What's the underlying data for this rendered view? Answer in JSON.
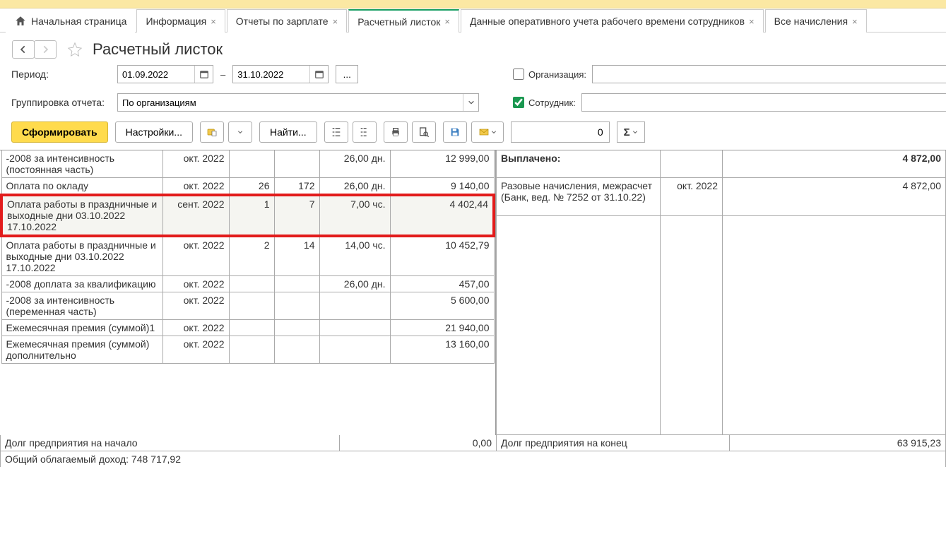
{
  "tabs": {
    "home": "Начальная страница",
    "info": "Информация",
    "reports": "Отчеты по зарплате",
    "payslip": "Расчетный листок",
    "worktime": "Данные оперативного учета рабочего времени сотрудников",
    "accruals": "Все начисления"
  },
  "title": "Расчетный листок",
  "labels": {
    "period": "Период:",
    "grouping": "Группировка отчета:",
    "org": "Организация:",
    "emp": "Сотрудник:"
  },
  "period": {
    "from": "01.09.2022",
    "to": "31.10.2022"
  },
  "grouping_value": "По организациям",
  "buttons": {
    "form": "Сформировать",
    "settings": "Настройки...",
    "find": "Найти..."
  },
  "numbox": "0",
  "left_rows": [
    {
      "name": "-2008 за интенсивность (постоянная  часть)",
      "period": "окт. 2022",
      "c1": "",
      "c2": "",
      "c3": "26,00 дн.",
      "sum": "12 999,00"
    },
    {
      "name": "Оплата по окладу",
      "period": "окт. 2022",
      "c1": "26",
      "c2": "172",
      "c3": "26,00 дн.",
      "sum": "9 140,00"
    },
    {
      "name": "Оплата работы в праздничные и выходные дни 03.10.2022 17.10.2022",
      "period": "сент. 2022",
      "c1": "1",
      "c2": "7",
      "c3": "7,00 чс.",
      "sum": "4 402,44",
      "hl": true
    },
    {
      "name": "Оплата работы в праздничные и выходные дни 03.10.2022 17.10.2022",
      "period": "окт. 2022",
      "c1": "2",
      "c2": "14",
      "c3": "14,00 чс.",
      "sum": "10 452,79"
    },
    {
      "name": "-2008 доплата за квалификацию",
      "period": "окт. 2022",
      "c1": "",
      "c2": "",
      "c3": "26,00 дн.",
      "sum": "457,00"
    },
    {
      "name": "-2008 за интенсивность (переменная часть)",
      "period": "окт. 2022",
      "c1": "",
      "c2": "",
      "c3": "",
      "sum": "5 600,00"
    },
    {
      "name": "Ежемесячная премия (суммой)1",
      "period": "окт. 2022",
      "c1": "",
      "c2": "",
      "c3": "",
      "sum": "21 940,00"
    },
    {
      "name": "Ежемесячная премия (суммой) дополнительно",
      "period": "окт. 2022",
      "c1": "",
      "c2": "",
      "c3": "",
      "sum": "13 160,00"
    }
  ],
  "right": {
    "paid_label": "Выплачено:",
    "paid_sum": "4 872,00",
    "row_name": "Разовые начисления, межрасчет (Банк, вед. № 7252 от 31.10.22)",
    "row_period": "окт. 2022",
    "row_sum": "4 872,00"
  },
  "footer": {
    "debt_start": "Долг предприятия на начало",
    "debt_start_val": "0,00",
    "debt_end": "Долг предприятия на конец",
    "debt_end_val": "63 915,23",
    "income": "Общий облагаемый доход: 748 717,92"
  }
}
